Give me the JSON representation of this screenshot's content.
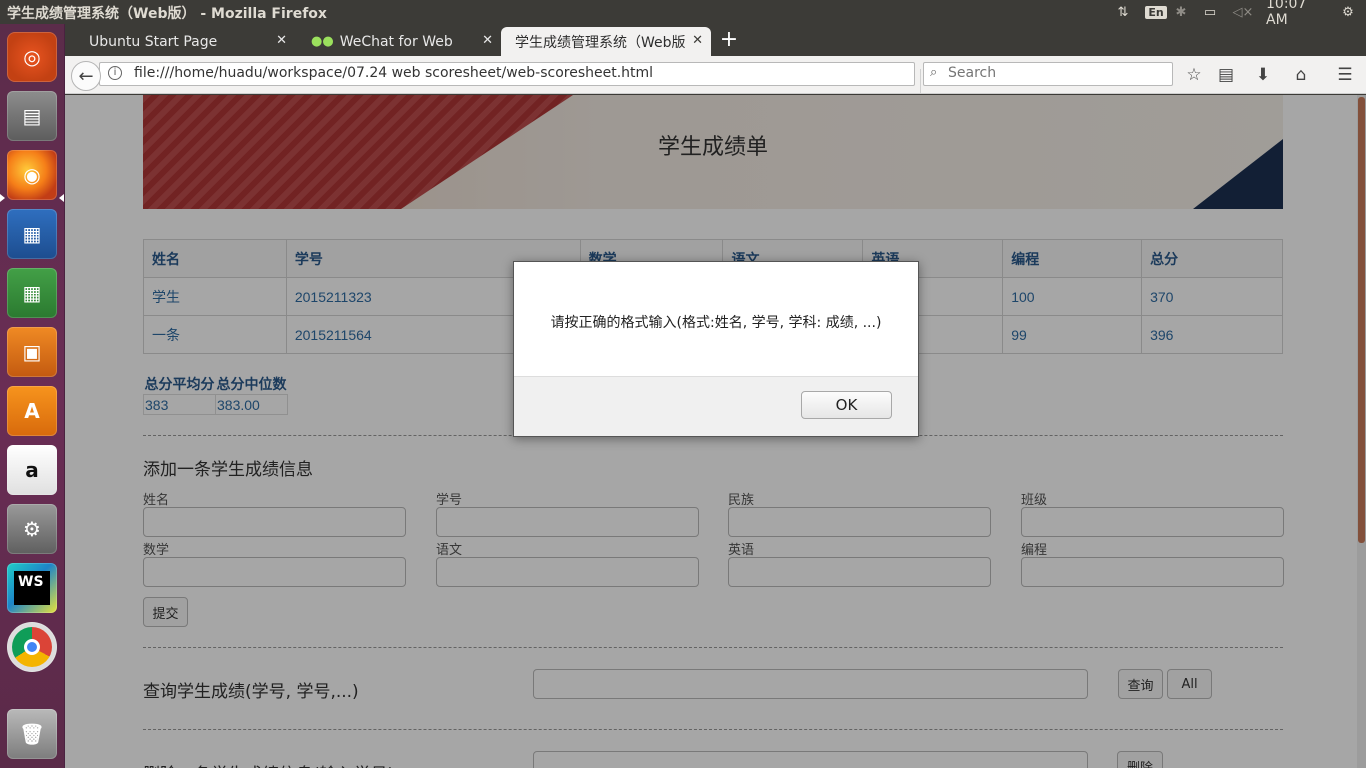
{
  "window": {
    "title": "学生成绩管理系统（Web版） - Mozilla Firefox"
  },
  "tray": {
    "keyboard": "En",
    "clock": "10:07 AM"
  },
  "tabs": [
    {
      "label": "Ubuntu Start Page"
    },
    {
      "label": "WeChat for Web"
    },
    {
      "label": "学生成绩管理系统（Web版"
    }
  ],
  "navbar": {
    "url": "file:///home/huadu/workspace/07.24 web scoresheet/web-scoresheet.html",
    "search_placeholder": "Search"
  },
  "page": {
    "banner_title": "学生成绩单",
    "table": {
      "headers": [
        "姓名",
        "学号",
        "数学",
        "语文",
        "英语",
        "编程",
        "总分"
      ],
      "rows": [
        [
          "学生",
          "2015211323",
          "",
          "",
          "",
          "100",
          "370"
        ],
        [
          "一条",
          "2015211564",
          "",
          "",
          "",
          "99",
          "396"
        ]
      ]
    },
    "stats": {
      "headers": [
        "总分平均分",
        "总分中位数"
      ],
      "values": [
        "383",
        "383.00"
      ]
    },
    "add_form": {
      "title": "添加一条学生成绩信息",
      "labels": [
        "姓名",
        "学号",
        "民族",
        "班级",
        "数学",
        "语文",
        "英语",
        "编程"
      ],
      "submit": "提交"
    },
    "query": {
      "title": "查询学生成绩(学号, 学号,...)",
      "button": "查询",
      "all_button": "All"
    },
    "delete": {
      "title": "删除一条学生成绩信息(输入学号)",
      "button": "删除"
    }
  },
  "dialog": {
    "message": "请按正确的格式输入(格式:姓名, 学号, 学科: 成绩, ...)",
    "ok": "OK"
  }
}
